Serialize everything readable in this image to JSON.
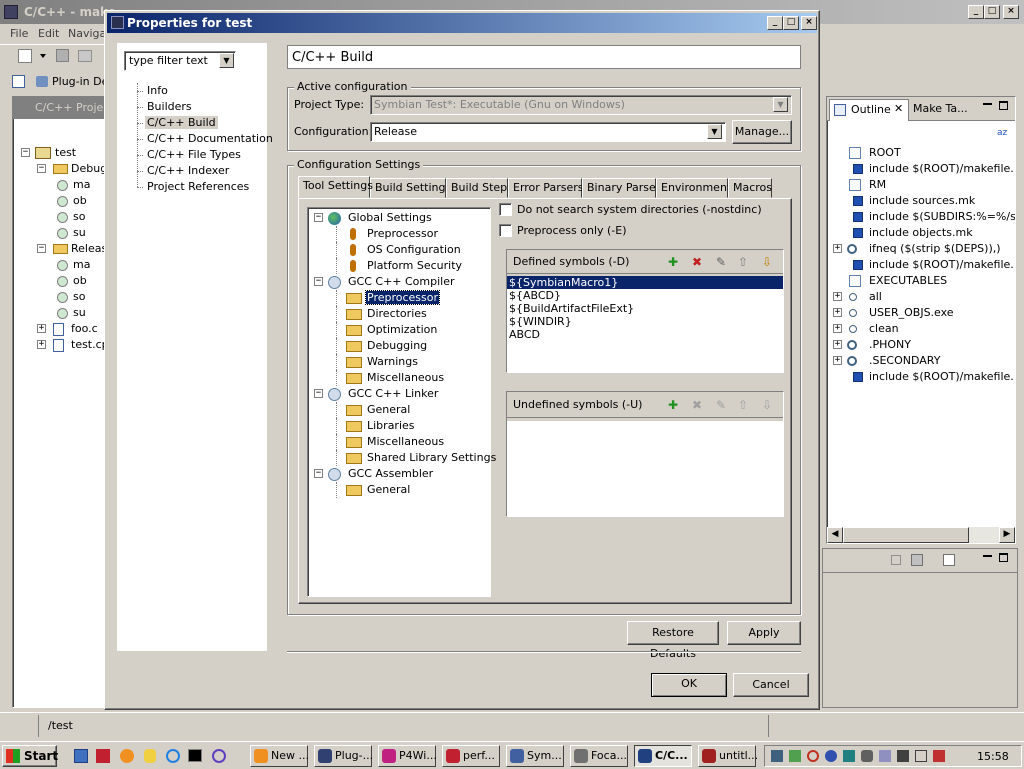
{
  "colors": {
    "titlebar_active": "#0a246a",
    "titlebar_active_end": "#a6caf0",
    "titlebar_inactive": "#808080",
    "selection": "#0a246a",
    "desktop": "#3a6ea5"
  },
  "eclipse": {
    "title": "C/C++ - make",
    "menu": [
      "File",
      "Edit",
      "Naviga"
    ],
    "perspective_tab": "Plug-in Dev",
    "project_view_title": "C/C++ Project",
    "project_tree": [
      {
        "label": "test",
        "level": 0,
        "icon": "project-icon",
        "expander": "−"
      },
      {
        "label": "Debug",
        "level": 1,
        "icon": "folder-icon",
        "expander": "−"
      },
      {
        "label": "ma",
        "level": 2,
        "icon": "file-icon"
      },
      {
        "label": "ob",
        "level": 2,
        "icon": "file-icon"
      },
      {
        "label": "so",
        "level": 2,
        "icon": "file-icon"
      },
      {
        "label": "su",
        "level": 2,
        "icon": "file-icon"
      },
      {
        "label": "Releas",
        "level": 1,
        "icon": "folder-icon",
        "expander": "−"
      },
      {
        "label": "ma",
        "level": 2,
        "icon": "file-icon"
      },
      {
        "label": "ob",
        "level": 2,
        "icon": "file-icon"
      },
      {
        "label": "so",
        "level": 2,
        "icon": "file-icon"
      },
      {
        "label": "su",
        "level": 2,
        "icon": "file-icon"
      },
      {
        "label": "foo.c",
        "level": 1,
        "icon": "c-file-icon",
        "expander": "+"
      },
      {
        "label": "test.cp",
        "level": 1,
        "icon": "cpp-file-icon",
        "expander": "+"
      }
    ],
    "outline": {
      "tab_label": "Outline",
      "maketargets_label": "Make Ta...",
      "sort_icon_label": "az",
      "items": [
        {
          "label": "ROOT",
          "icon": "doc-icon",
          "expander": ""
        },
        {
          "label": "include $(ROOT)/makefile. ...",
          "icon": "include-icon",
          "expander": ""
        },
        {
          "label": "RM",
          "icon": "doc-icon",
          "expander": ""
        },
        {
          "label": "include sources.mk",
          "icon": "include-icon",
          "expander": ""
        },
        {
          "label": "include $(SUBDIRS:%=%/sub",
          "icon": "include-icon",
          "expander": ""
        },
        {
          "label": "include objects.mk",
          "icon": "include-icon",
          "expander": ""
        },
        {
          "label": "ifneq ($(strip $(DEPS)),)",
          "icon": "condition-icon",
          "expander": "+"
        },
        {
          "label": "include $(ROOT)/makefile. ...",
          "icon": "include-icon",
          "expander": ""
        },
        {
          "label": "EXECUTABLES",
          "icon": "doc-icon",
          "expander": ""
        },
        {
          "label": "all",
          "icon": "target-icon",
          "expander": "+"
        },
        {
          "label": "USER_OBJS.exe",
          "icon": "target-icon",
          "expander": "+"
        },
        {
          "label": "clean",
          "icon": "target-icon",
          "expander": "+"
        },
        {
          "label": ".PHONY",
          "icon": "condition-icon",
          "expander": "+"
        },
        {
          "label": ".SECONDARY",
          "icon": "condition-icon",
          "expander": "+"
        },
        {
          "label": "include $(ROOT)/makefile. ...",
          "icon": "include-icon",
          "expander": ""
        }
      ]
    },
    "status_path": "/test"
  },
  "dialog": {
    "title": "Properties for test",
    "filter_placeholder": "type filter text",
    "nav_items": [
      "Info",
      "Builders",
      "C/C++ Build",
      "C/C++ Documentation",
      "C/C++ File Types",
      "C/C++ Indexer",
      "Project References"
    ],
    "selected_nav": "C/C++ Build",
    "page_title": "C/C++ Build",
    "active_config": {
      "group_label": "Active configuration",
      "project_type_label": "Project Type:",
      "project_type_value": "Symbian Test*: Executable (Gnu on Windows)",
      "configuration_label": "Configuration:",
      "configuration_value": "Release",
      "manage_label": "Manage..."
    },
    "config_settings": {
      "group_label": "Configuration Settings",
      "tabs": [
        "Tool Settings",
        "Build Settings",
        "Build Steps",
        "Error Parsers",
        "Binary Parser",
        "Environment",
        "Macros"
      ],
      "active_tab": "Tool Settings",
      "tool_tree": [
        {
          "label": "Global Settings",
          "level": 0,
          "icon": "globe-icon",
          "expander": "−"
        },
        {
          "label": "Preprocessor",
          "level": 1,
          "icon": "diamond-icon"
        },
        {
          "label": "OS Configuration",
          "level": 1,
          "icon": "diamond-icon"
        },
        {
          "label": "Platform Security",
          "level": 1,
          "icon": "diamond-icon"
        },
        {
          "label": "GCC C++ Compiler",
          "level": 0,
          "icon": "tool-icon",
          "expander": "−"
        },
        {
          "label": "Preprocessor",
          "level": 1,
          "icon": "option-folder-icon",
          "selected": true
        },
        {
          "label": "Directories",
          "level": 1,
          "icon": "option-folder-icon"
        },
        {
          "label": "Optimization",
          "level": 1,
          "icon": "option-folder-icon"
        },
        {
          "label": "Debugging",
          "level": 1,
          "icon": "option-folder-icon"
        },
        {
          "label": "Warnings",
          "level": 1,
          "icon": "option-folder-icon"
        },
        {
          "label": "Miscellaneous",
          "level": 1,
          "icon": "option-folder-icon"
        },
        {
          "label": "GCC C++ Linker",
          "level": 0,
          "icon": "tool-icon",
          "expander": "−"
        },
        {
          "label": "General",
          "level": 1,
          "icon": "option-folder-icon"
        },
        {
          "label": "Libraries",
          "level": 1,
          "icon": "option-folder-icon"
        },
        {
          "label": "Miscellaneous",
          "level": 1,
          "icon": "option-folder-icon"
        },
        {
          "label": "Shared Library Settings",
          "level": 1,
          "icon": "option-folder-icon"
        },
        {
          "label": "GCC Assembler",
          "level": 0,
          "icon": "tool-icon",
          "expander": "−"
        },
        {
          "label": "General",
          "level": 1,
          "icon": "option-folder-icon"
        }
      ],
      "nostdinc_label": "Do not search system directories (-nostdinc)",
      "nostdinc_checked": false,
      "preprocess_only_label": "Preprocess only (-E)",
      "preprocess_only_checked": false,
      "defined_symbols_label": "Defined symbols (-D)",
      "defined_symbols": [
        "${SymbianMacro1}",
        "${ABCD}",
        "${BuildArtifactFileExt}",
        "${WINDIR}",
        "ABCD"
      ],
      "selected_symbol_index": 0,
      "undefined_symbols_label": "Undefined symbols (-U)",
      "undefined_symbols": []
    },
    "restore_defaults_label": "Restore Defaults",
    "apply_label": "Apply",
    "ok_label": "OK",
    "cancel_label": "Cancel"
  },
  "taskbar": {
    "start_label": "Start",
    "tasks": [
      "New ...",
      "Plug-...",
      "P4Wi...",
      "perf...",
      "Sym...",
      "Foca...",
      "C/C...",
      "untitl..."
    ],
    "active_task_index": 6,
    "clock": "15:58"
  }
}
